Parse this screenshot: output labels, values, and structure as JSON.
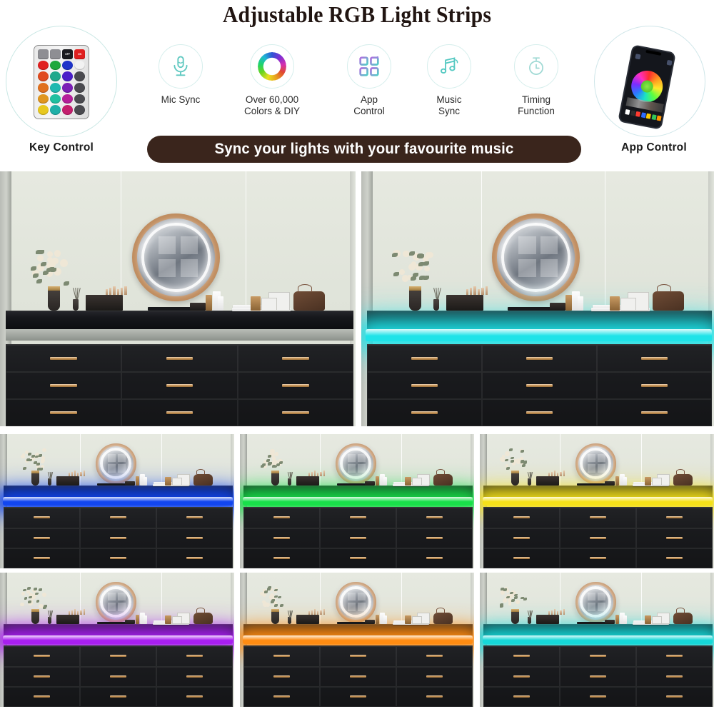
{
  "header": {
    "title": "Adjustable RGB Light Strips",
    "banner_text": "Sync your lights with your favourite music",
    "banner_bg": "#3a251c",
    "left_badge": {
      "label": "Key Control",
      "icon": "remote-control-icon"
    },
    "right_badge": {
      "label": "App Control",
      "icon": "smartphone-app-icon"
    },
    "features": [
      {
        "id": "mic-sync",
        "label": "Mic Sync",
        "icon": "microphone-icon",
        "color": "#5ec8c0"
      },
      {
        "id": "colors-diy",
        "label": "Over 60,000\nColors & DIY",
        "icon": "color-wheel-icon",
        "color": "#b36bd6"
      },
      {
        "id": "app-control",
        "label": "App\nControl",
        "icon": "app-grid-icon",
        "color": "#9b7fe0"
      },
      {
        "id": "music-sync",
        "label": "Music\nSync",
        "icon": "music-note-icon",
        "color": "#55c9c2"
      },
      {
        "id": "timing",
        "label": "Timing\nFunction",
        "icon": "timer-icon",
        "color": "#9fd9d4"
      }
    ]
  },
  "remote": {
    "rows": [
      [
        "#8e8e93",
        "#8e8e93",
        "#1b1b1f",
        "#e02020"
      ],
      [
        "#e01f1f",
        "#1fa83c",
        "#1e34c9",
        "#f2f2f2"
      ],
      [
        "#e04a1f",
        "#1fa88c",
        "#4a1fc9",
        "#4a4a4f"
      ],
      [
        "#e0701f",
        "#1fb8b0",
        "#7a1fb5",
        "#4a4a4f"
      ],
      [
        "#e0961f",
        "#1fc0a0",
        "#b51f9a",
        "#4a4a4f"
      ],
      [
        "#e8c81f",
        "#1fb0a8",
        "#c41f6e",
        "#4a4a4f"
      ]
    ],
    "top_labels": [
      "",
      "",
      "OFF",
      "ON"
    ]
  },
  "phone": {
    "swatches": [
      "#ffffff",
      "#2e2e2e",
      "#ff3b30",
      "#2d6cff",
      "#ffcc00",
      "#34c759",
      "#ff9500"
    ]
  },
  "gallery": {
    "tiles": [
      {
        "id": "tile-off-left",
        "label": "dresser-no-light",
        "led_color": "",
        "led_on": false,
        "drawer_rows": 3,
        "row": 0,
        "col": 0
      },
      {
        "id": "tile-cyan-right",
        "label": "dresser-cyan-light",
        "led_color": "#1fe3e8",
        "led_on": true,
        "drawer_rows": 3,
        "row": 0,
        "col": 1
      },
      {
        "id": "tile-blue",
        "label": "dresser-blue-light",
        "led_color": "#1246f0",
        "led_on": true,
        "drawer_rows": 3,
        "row": 1,
        "col": 0
      },
      {
        "id": "tile-green",
        "label": "dresser-green-light",
        "led_color": "#19e04a",
        "led_on": true,
        "drawer_rows": 3,
        "row": 1,
        "col": 1
      },
      {
        "id": "tile-yellow",
        "label": "dresser-yellow-light",
        "led_color": "#f5e11a",
        "led_on": true,
        "drawer_rows": 3,
        "row": 1,
        "col": 2
      },
      {
        "id": "tile-purple",
        "label": "dresser-purple-light",
        "led_color": "#a81ff0",
        "led_on": true,
        "drawer_rows": 3,
        "row": 2,
        "col": 0
      },
      {
        "id": "tile-orange",
        "label": "dresser-orange-light",
        "led_color": "#ff8c12",
        "led_on": true,
        "drawer_rows": 3,
        "row": 2,
        "col": 1
      },
      {
        "id": "tile-teal",
        "label": "dresser-teal-light",
        "led_color": "#16d8d8",
        "led_on": true,
        "drawer_rows": 3,
        "row": 2,
        "col": 2
      }
    ],
    "scene": {
      "description": "black 9-drawer dresser with rose-gold handles, round LED wall mirror, flower vase, cosmetics, perfume bottles, books and leather handbag",
      "wall_color": "#e2e6dc",
      "dresser_color": "#17181b",
      "handle_color": "#c89557",
      "mirror_frame_color": "#c08d5f"
    }
  }
}
